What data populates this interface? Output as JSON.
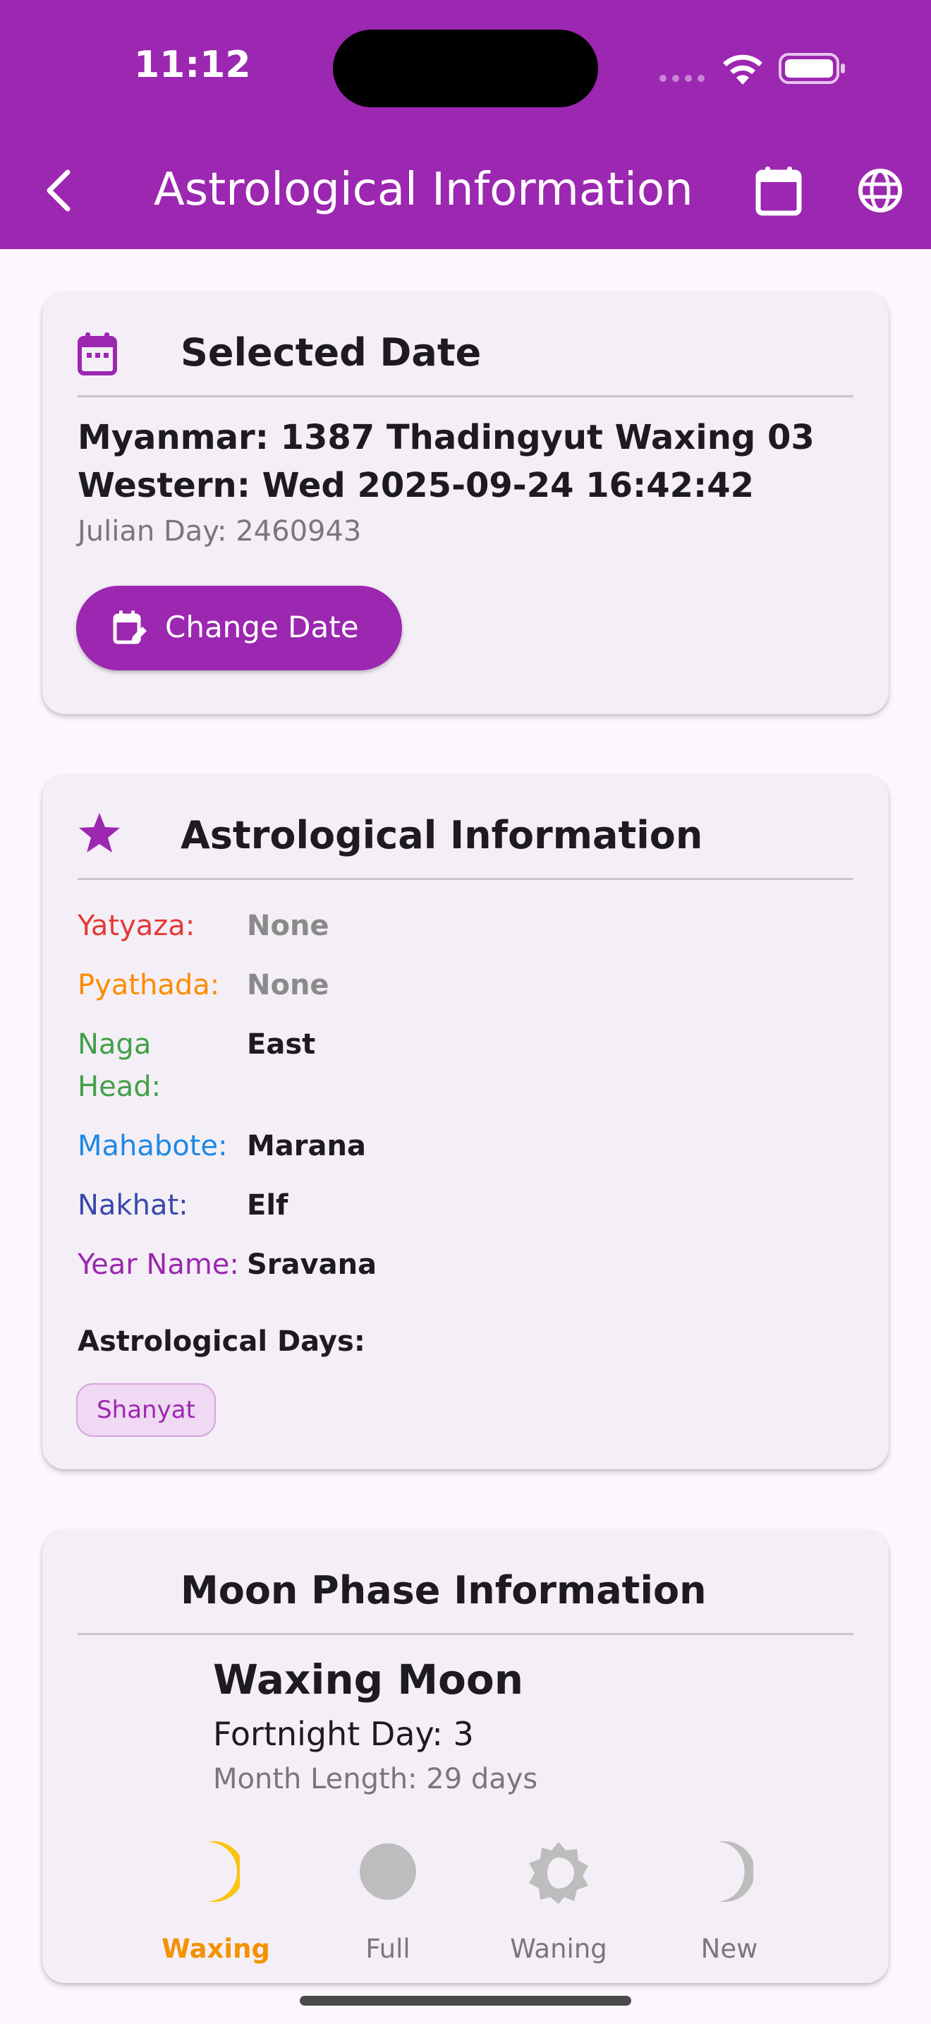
{
  "status_bar": {
    "time": "11:12"
  },
  "app_bar": {
    "title": "Astrological Information"
  },
  "selected_date": {
    "heading": "Selected Date",
    "myanmar": "Myanmar: 1387 Thadingyut Waxing 03",
    "western": "Western: Wed 2025-09-24 16:42:42",
    "julian": "Julian Day: 2460943",
    "button_label": "Change Date"
  },
  "astro": {
    "heading": "Astrological Information",
    "rows": [
      {
        "key": "Yatyaza:",
        "value": "None",
        "key_color": "#e53935"
      },
      {
        "key": "Pyathada:",
        "value": "None",
        "key_color": "#fb8c00"
      },
      {
        "key": "Naga\nHead:",
        "value": "East",
        "key_color": "#43a047"
      },
      {
        "key": "Mahabote:",
        "value": "Marana",
        "key_color": "#1e88e5"
      },
      {
        "key": "Nakhat:",
        "value": "Elf",
        "key_color": "#3949ab"
      },
      {
        "key": "Year Name:",
        "value": "Sravana",
        "key_color": "#9c27b0"
      }
    ],
    "days_label": "Astrological Days:",
    "days": [
      "Shanyat"
    ]
  },
  "moon": {
    "heading": "Moon Phase Information",
    "phase_name": "Waxing Moon",
    "fortnight": "Fortnight Day: 3",
    "month_length": "Month Length: 29 days",
    "phases": [
      "Waxing",
      "Full",
      "Waning",
      "New"
    ],
    "active_phase": "Waxing"
  },
  "colors": {
    "primary": "#9c27b0",
    "moon_yellow": "#fbc312",
    "active_orange": "#f39200",
    "inactive_gray": "#bdbdbd"
  }
}
